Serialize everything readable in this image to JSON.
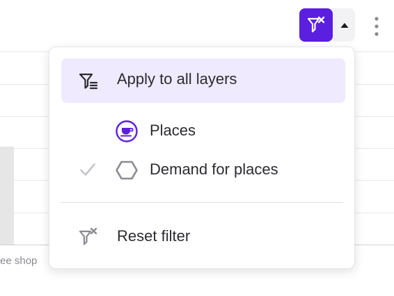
{
  "background": {
    "partial_label": "ee shop"
  },
  "toolbar": {
    "filter_button_icon": "filter-clear-icon",
    "caret_icon": "caret-up-icon",
    "more_icon": "more-vertical-icon",
    "accent_color": "#5b1fe0"
  },
  "dropdown": {
    "apply_all": {
      "label": "Apply to all layers",
      "icon": "filter-list-icon",
      "highlight_color": "#efeafd"
    },
    "layers": [
      {
        "label": "Places",
        "icon": "cup-circle-icon",
        "checked": false
      },
      {
        "label": "Demand for places",
        "icon": "hexagon-icon",
        "checked": true
      }
    ],
    "reset": {
      "label": "Reset filter",
      "icon": "filter-clear-icon"
    }
  }
}
